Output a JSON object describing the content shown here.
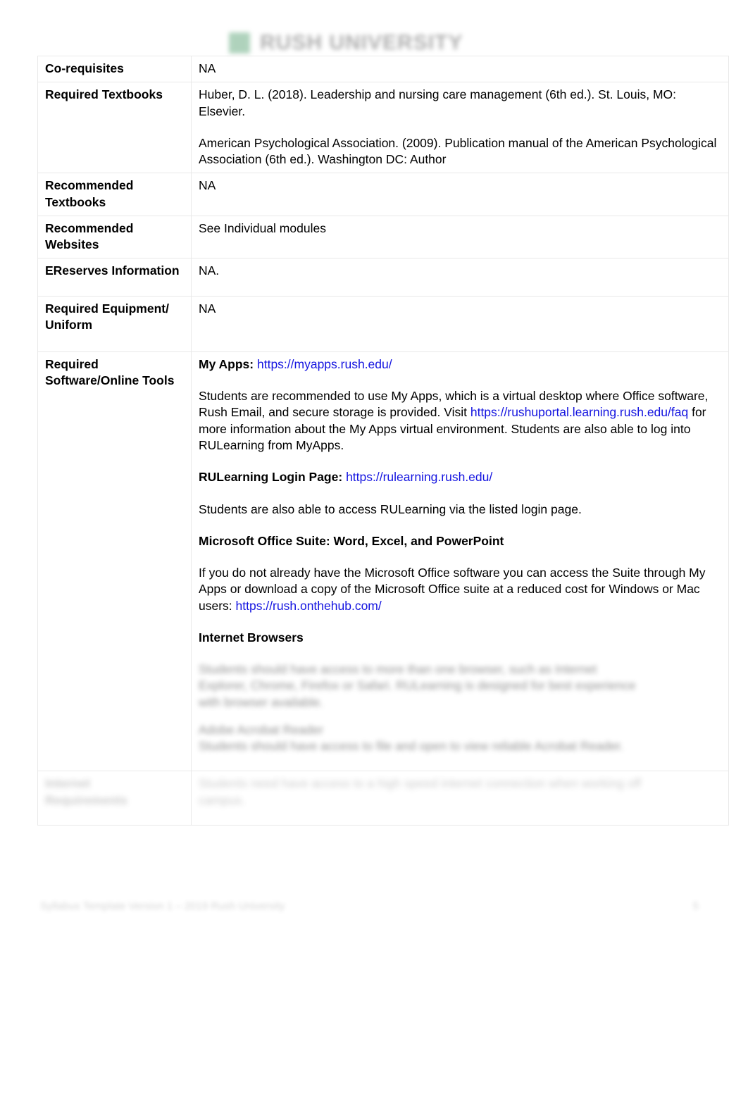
{
  "header": {
    "logo_icon": "rush-university-logo-mark",
    "logo_text": "RUSH UNIVERSITY"
  },
  "table": {
    "rows": [
      {
        "label": "Co-requisites",
        "value_paragraphs": [
          {
            "text": "NA"
          }
        ]
      },
      {
        "label": "Required Textbooks",
        "value_paragraphs": [
          {
            "text": "Huber, D. L. (2018). Leadership and nursing care management (6th ed.). St. Louis, MO: Elsevier."
          },
          {
            "text": "American Psychological Association. (2009). Publication manual of the American Psychological Association (6th ed.). Washington DC: Author"
          }
        ]
      },
      {
        "label": "Recommended Textbooks",
        "value_paragraphs": [
          {
            "text": "NA"
          }
        ]
      },
      {
        "label": "Recommended Websites",
        "value_paragraphs": [
          {
            "text": "See Individual modules"
          }
        ]
      },
      {
        "label": "EReserves Information",
        "value_paragraphs": [
          {
            "text": "NA."
          }
        ]
      },
      {
        "label": "Required Equipment/ Uniform",
        "value_paragraphs": [
          {
            "text": "NA"
          }
        ]
      }
    ],
    "software_row": {
      "label": "Required Software/Online Tools",
      "myapps_label": "My Apps:",
      "myapps_url": "https://myapps.rush.edu/",
      "myapps_paragraph_part1": "Students are recommended to use My Apps, which is a virtual desktop where Office software, Rush Email, and secure storage is provided.  Visit ",
      "myapps_faq_url": "https://rushuportal.learning.rush.edu/faq",
      "myapps_paragraph_part2": " for more information about the My Apps virtual environment. Students are also able to log into RULearning from MyApps.",
      "rulearning_label": "RULearning Login Page:",
      "rulearning_url": "https://rulearning.rush.edu/",
      "rulearning_paragraph": "Students are also able to access RULearning via the listed login page.",
      "office_heading": "Microsoft Office Suite: Word, Excel, and PowerPoint",
      "office_paragraph_part1": "If you do not already have the Microsoft Office software you can access the Suite through My Apps or download a copy of the Microsoft Office suite at a reduced cost for Windows or Mac users: ",
      "office_url": "https://rush.onthehub.com/",
      "browsers_heading": "Internet Browsers",
      "browsers_blurred_line1": "Students should have access to more than one browser, such as Internet",
      "browsers_blurred_line2": "Explorer, Chrome, Firefox or Safari.  RULearning is designed for best experience",
      "browsers_blurred_line3": "with browser available.",
      "browsers_blurred_line4": "Adobe Acrobat Reader",
      "browsers_blurred_line5": "Students should have access to file and open to view reliable Acrobat Reader."
    },
    "last_row": {
      "label_blurred_line1": "Internet",
      "label_blurred_line2": "Requirements",
      "value_blurred_line1": "Students need have access to a high speed internet connection when working off",
      "value_blurred_line2": "campus."
    }
  },
  "footer": {
    "left_text_blurred": "Syllabus Template Version 1 – 2019 Rush University",
    "page_number_blurred": "5"
  }
}
